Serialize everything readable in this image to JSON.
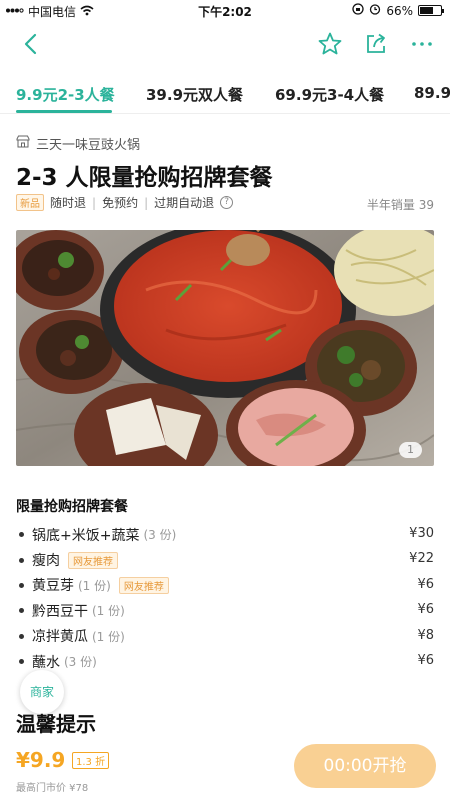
{
  "status_bar": {
    "carrier": "中国电信",
    "time": "下午2:02",
    "battery": "66%",
    "battery_level": 0.66
  },
  "tabs": [
    {
      "label": "9.9元2-3人餐",
      "active": true
    },
    {
      "label": "39.9元双人餐",
      "active": false
    },
    {
      "label": "69.9元3-4人餐",
      "active": false
    },
    {
      "label": "89.9",
      "active": false
    }
  ],
  "store": {
    "name": "三天一味豆豉火锅"
  },
  "deal": {
    "title": "2-3 人限量抢购招牌套餐",
    "new_tag": "新品",
    "policies": [
      "随时退",
      "免预约",
      "过期自动退"
    ],
    "sales": "半年销量 39",
    "image_counter": "1"
  },
  "menu": {
    "title": "限量抢购招牌套餐",
    "items": [
      {
        "name": "锅底+米饭+蔬菜",
        "qty": "(3 份)",
        "badge": "",
        "price": "¥30"
      },
      {
        "name": "瘦肉",
        "qty": "",
        "badge": "网友推荐",
        "price": "¥22"
      },
      {
        "name": "黄豆芽",
        "qty": "(1 份)",
        "badge": "网友推荐",
        "price": "¥6"
      },
      {
        "name": "黔西豆干",
        "qty": "(1 份)",
        "badge": "",
        "price": "¥6"
      },
      {
        "name": "凉拌黄瓜",
        "qty": "(1 份)",
        "badge": "",
        "price": "¥8"
      },
      {
        "name": "蘸水",
        "qty": "(3 份)",
        "badge": "",
        "price": "¥6"
      }
    ]
  },
  "merchant_button": "商家",
  "tips_title": "温馨提示",
  "bottom": {
    "price": "¥9.9",
    "discount": "1.3 折",
    "original": "最高门市价 ¥78",
    "buy_button": "00:00开抢"
  },
  "colors": {
    "accent": "#2bb39b",
    "price": "#f5a623",
    "buy_button": "#f9d093"
  }
}
